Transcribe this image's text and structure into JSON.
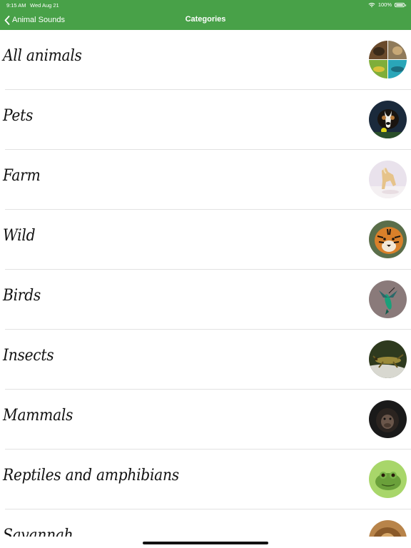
{
  "status_bar": {
    "time": "9:15 AM",
    "date": "Wed Aug 21",
    "battery": "100%"
  },
  "nav": {
    "back_label": "Animal Sounds",
    "title": "Categories"
  },
  "categories": [
    {
      "label": "All animals",
      "icon": "all-animals-thumbnail"
    },
    {
      "label": "Pets",
      "icon": "dog-thumbnail"
    },
    {
      "label": "Farm",
      "icon": "horse-thumbnail"
    },
    {
      "label": "Wild",
      "icon": "tiger-thumbnail"
    },
    {
      "label": "Birds",
      "icon": "hummingbird-thumbnail"
    },
    {
      "label": "Insects",
      "icon": "grasshopper-thumbnail"
    },
    {
      "label": "Mammals",
      "icon": "chimpanzee-thumbnail"
    },
    {
      "label": "Reptiles and amphibians",
      "icon": "frog-thumbnail"
    },
    {
      "label": "Savannah",
      "icon": "lion-thumbnail"
    }
  ],
  "colors": {
    "nav_bar": "#48a148",
    "text": "#111111",
    "divider": "#e2e2e2"
  }
}
